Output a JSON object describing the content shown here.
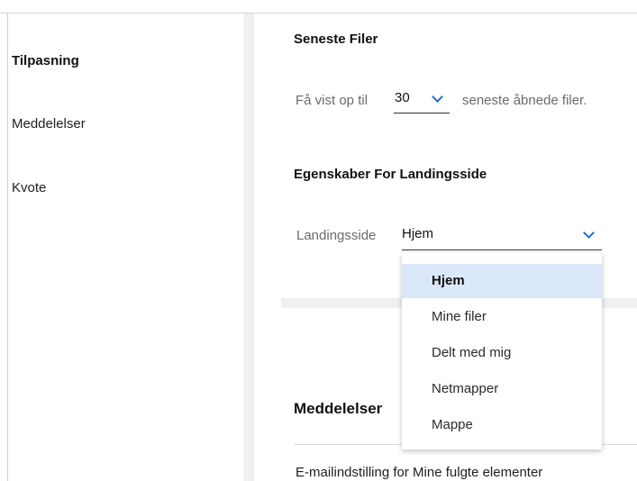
{
  "sidebar": {
    "items": [
      {
        "label": "Tilpasning",
        "active": true
      },
      {
        "label": "Meddelelser",
        "active": false
      },
      {
        "label": "Kvote",
        "active": false
      }
    ]
  },
  "recent_files": {
    "heading": "Seneste Filer",
    "prefix": "Få vist op til",
    "count_value": "30",
    "suffix": "seneste åbnede filer."
  },
  "landing": {
    "heading": "Egenskaber For Landingsside",
    "label": "Landingsside",
    "selected": "Hjem",
    "options": [
      "Hjem",
      "Mine filer",
      "Delt med mig",
      "Netmapper",
      "Mappe"
    ]
  },
  "notifications": {
    "heading": "Meddelelser",
    "email_setting": "E-mailindstilling for Mine fulgte elementer"
  },
  "colors": {
    "accent": "#1f6fc9",
    "selected_option_bg": "#dbe8f9",
    "gutter": "#f0f0f0"
  },
  "icons": {
    "dropdown": "chevron-down-icon"
  }
}
